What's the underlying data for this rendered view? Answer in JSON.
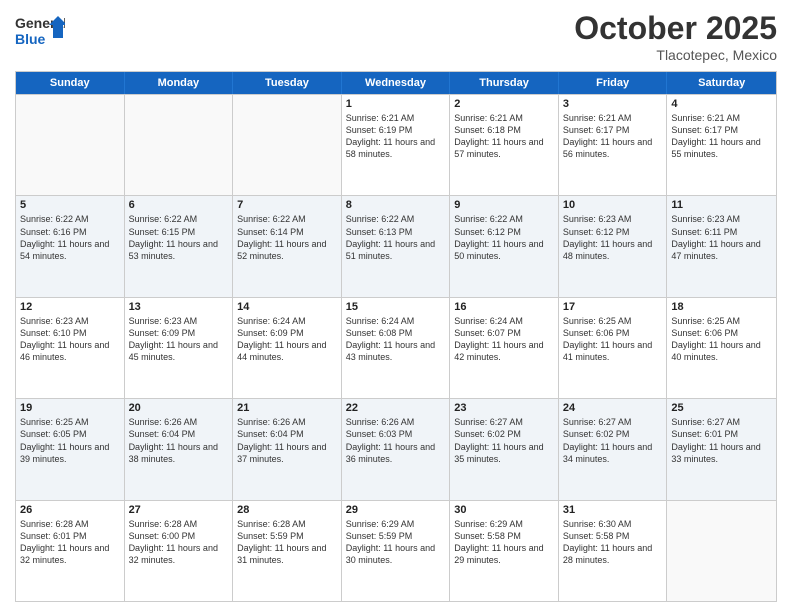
{
  "logo": {
    "general": "General",
    "blue": "Blue"
  },
  "title": "October 2025",
  "subtitle": "Tlacotepec, Mexico",
  "days_of_week": [
    "Sunday",
    "Monday",
    "Tuesday",
    "Wednesday",
    "Thursday",
    "Friday",
    "Saturday"
  ],
  "weeks": [
    [
      {
        "day": "",
        "info": ""
      },
      {
        "day": "",
        "info": ""
      },
      {
        "day": "",
        "info": ""
      },
      {
        "day": "1",
        "info": "Sunrise: 6:21 AM\nSunset: 6:19 PM\nDaylight: 11 hours and 58 minutes."
      },
      {
        "day": "2",
        "info": "Sunrise: 6:21 AM\nSunset: 6:18 PM\nDaylight: 11 hours and 57 minutes."
      },
      {
        "day": "3",
        "info": "Sunrise: 6:21 AM\nSunset: 6:17 PM\nDaylight: 11 hours and 56 minutes."
      },
      {
        "day": "4",
        "info": "Sunrise: 6:21 AM\nSunset: 6:17 PM\nDaylight: 11 hours and 55 minutes."
      }
    ],
    [
      {
        "day": "5",
        "info": "Sunrise: 6:22 AM\nSunset: 6:16 PM\nDaylight: 11 hours and 54 minutes."
      },
      {
        "day": "6",
        "info": "Sunrise: 6:22 AM\nSunset: 6:15 PM\nDaylight: 11 hours and 53 minutes."
      },
      {
        "day": "7",
        "info": "Sunrise: 6:22 AM\nSunset: 6:14 PM\nDaylight: 11 hours and 52 minutes."
      },
      {
        "day": "8",
        "info": "Sunrise: 6:22 AM\nSunset: 6:13 PM\nDaylight: 11 hours and 51 minutes."
      },
      {
        "day": "9",
        "info": "Sunrise: 6:22 AM\nSunset: 6:12 PM\nDaylight: 11 hours and 50 minutes."
      },
      {
        "day": "10",
        "info": "Sunrise: 6:23 AM\nSunset: 6:12 PM\nDaylight: 11 hours and 48 minutes."
      },
      {
        "day": "11",
        "info": "Sunrise: 6:23 AM\nSunset: 6:11 PM\nDaylight: 11 hours and 47 minutes."
      }
    ],
    [
      {
        "day": "12",
        "info": "Sunrise: 6:23 AM\nSunset: 6:10 PM\nDaylight: 11 hours and 46 minutes."
      },
      {
        "day": "13",
        "info": "Sunrise: 6:23 AM\nSunset: 6:09 PM\nDaylight: 11 hours and 45 minutes."
      },
      {
        "day": "14",
        "info": "Sunrise: 6:24 AM\nSunset: 6:09 PM\nDaylight: 11 hours and 44 minutes."
      },
      {
        "day": "15",
        "info": "Sunrise: 6:24 AM\nSunset: 6:08 PM\nDaylight: 11 hours and 43 minutes."
      },
      {
        "day": "16",
        "info": "Sunrise: 6:24 AM\nSunset: 6:07 PM\nDaylight: 11 hours and 42 minutes."
      },
      {
        "day": "17",
        "info": "Sunrise: 6:25 AM\nSunset: 6:06 PM\nDaylight: 11 hours and 41 minutes."
      },
      {
        "day": "18",
        "info": "Sunrise: 6:25 AM\nSunset: 6:06 PM\nDaylight: 11 hours and 40 minutes."
      }
    ],
    [
      {
        "day": "19",
        "info": "Sunrise: 6:25 AM\nSunset: 6:05 PM\nDaylight: 11 hours and 39 minutes."
      },
      {
        "day": "20",
        "info": "Sunrise: 6:26 AM\nSunset: 6:04 PM\nDaylight: 11 hours and 38 minutes."
      },
      {
        "day": "21",
        "info": "Sunrise: 6:26 AM\nSunset: 6:04 PM\nDaylight: 11 hours and 37 minutes."
      },
      {
        "day": "22",
        "info": "Sunrise: 6:26 AM\nSunset: 6:03 PM\nDaylight: 11 hours and 36 minutes."
      },
      {
        "day": "23",
        "info": "Sunrise: 6:27 AM\nSunset: 6:02 PM\nDaylight: 11 hours and 35 minutes."
      },
      {
        "day": "24",
        "info": "Sunrise: 6:27 AM\nSunset: 6:02 PM\nDaylight: 11 hours and 34 minutes."
      },
      {
        "day": "25",
        "info": "Sunrise: 6:27 AM\nSunset: 6:01 PM\nDaylight: 11 hours and 33 minutes."
      }
    ],
    [
      {
        "day": "26",
        "info": "Sunrise: 6:28 AM\nSunset: 6:01 PM\nDaylight: 11 hours and 32 minutes."
      },
      {
        "day": "27",
        "info": "Sunrise: 6:28 AM\nSunset: 6:00 PM\nDaylight: 11 hours and 32 minutes."
      },
      {
        "day": "28",
        "info": "Sunrise: 6:28 AM\nSunset: 5:59 PM\nDaylight: 11 hours and 31 minutes."
      },
      {
        "day": "29",
        "info": "Sunrise: 6:29 AM\nSunset: 5:59 PM\nDaylight: 11 hours and 30 minutes."
      },
      {
        "day": "30",
        "info": "Sunrise: 6:29 AM\nSunset: 5:58 PM\nDaylight: 11 hours and 29 minutes."
      },
      {
        "day": "31",
        "info": "Sunrise: 6:30 AM\nSunset: 5:58 PM\nDaylight: 11 hours and 28 minutes."
      },
      {
        "day": "",
        "info": ""
      }
    ]
  ]
}
